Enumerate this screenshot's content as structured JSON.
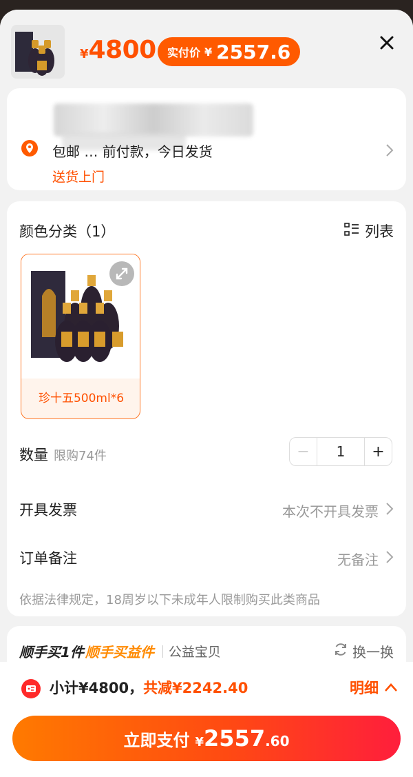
{
  "product": {
    "currency": "¥",
    "price": "4800",
    "real_price_label": "实付价",
    "real_price": "2557.6"
  },
  "address": {
    "line": "包邮  …  前付款，今日发货",
    "delivery": "送货上门"
  },
  "spec": {
    "title": "颜色分类（1）",
    "list_label": "列表",
    "option_label": "珍十五500ml*6"
  },
  "quantity": {
    "label": "数量",
    "limit": "限购74件",
    "value": "1",
    "minus": "−",
    "plus": "+"
  },
  "invoice": {
    "label": "开具发票",
    "value": "本次不开具发票"
  },
  "note": {
    "label": "订单备注",
    "value": "无备注"
  },
  "legal_notice": "依据法律规定，18周岁以下未成年人限制购买此类商品",
  "recommend": {
    "title_a": "顺手买1件",
    "title_b": "顺手买益件",
    "tag": "公益宝贝",
    "swap": "换一换"
  },
  "footer": {
    "subtotal": "小计¥4800，",
    "saved": "共减¥2242.40",
    "detail": "明细",
    "pay_label": "立即支付",
    "pay_currency": "¥",
    "pay_int": "2557",
    "pay_dec": ".60"
  },
  "colors": {
    "accent": "#ff5000",
    "pill": "#ff5a00"
  }
}
